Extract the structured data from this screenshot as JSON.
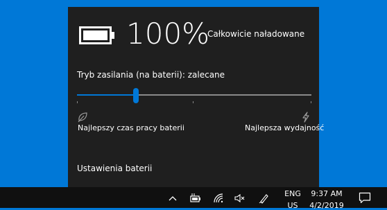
{
  "flyout": {
    "battery_percent": "100%",
    "battery_status": "Całkowicie naładowane",
    "power_mode_label": "Tryb zasilania (na baterii): zalecane",
    "slider": {
      "value_fraction": 0.25,
      "min_label": "Najlepszy czas pracy baterii",
      "max_label": "Najlepsza wydajność"
    },
    "settings_link": "Ustawienia baterii"
  },
  "taskbar": {
    "language": "ENG",
    "region": "US",
    "time": "9:37 AM",
    "date": "4/2/2019",
    "icons": [
      "chevron-up-icon",
      "battery-plug-icon",
      "wifi-icon",
      "volume-mute-icon",
      "pen-icon",
      "notification-icon"
    ]
  },
  "colors": {
    "desktop": "#0078d7",
    "accent": "#0078d7",
    "flyout_bg": "#1f1f1f",
    "taskbar_bg": "#101010"
  }
}
